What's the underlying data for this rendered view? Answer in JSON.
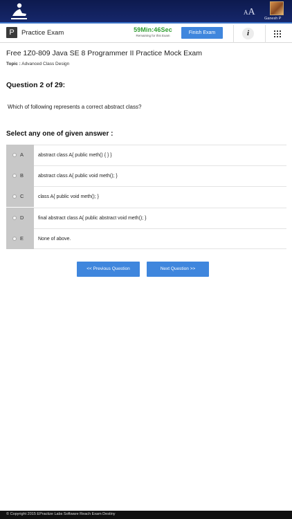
{
  "header": {
    "logo_icon": "reader-logo-icon",
    "font_size_icon": "font-size-icon",
    "font_size_small": "A",
    "font_size_big": "A",
    "user_name": "Ganesh P",
    "background_color": "#14235f",
    "accent_color": "#3b73c9"
  },
  "subheader": {
    "badge": "P",
    "title": "Practice Exam",
    "timer_value": "59Min:46Sec",
    "timer_caption": "Remaining for this Exam",
    "timer_color": "#2f9e2f",
    "finish_label": "Finish Exam",
    "info_icon": "i",
    "apps_icon": "grid-icon"
  },
  "exam": {
    "title": "Free 1Z0-809 Java SE 8 Programmer II Practice Mock Exam",
    "topic_label": "Topic :",
    "topic_value": "Advanced Class Design"
  },
  "question": {
    "number_label": "Question 2 of 29:",
    "text": "Which of following represents a correct abstract class?",
    "select_label": "Select any one of given answer :"
  },
  "options": [
    {
      "key": "A",
      "text": "abstract class A{ public meth() { } }"
    },
    {
      "key": "B",
      "text": "abstract class A{ public void meth(); }"
    },
    {
      "key": "C",
      "text": "class A{ public void meth(); }"
    },
    {
      "key": "D",
      "text": "final abstract class A{ public abstract void meth(); }"
    },
    {
      "key": "E",
      "text": "None of above."
    }
  ],
  "navigation": {
    "previous_label": "<< Previous Question",
    "next_label": "Next Question >>",
    "button_color": "#3f86dd"
  },
  "footer": {
    "text": "© Copyright 2015 EPractize Labs Software   Reach Exam Destiny"
  }
}
